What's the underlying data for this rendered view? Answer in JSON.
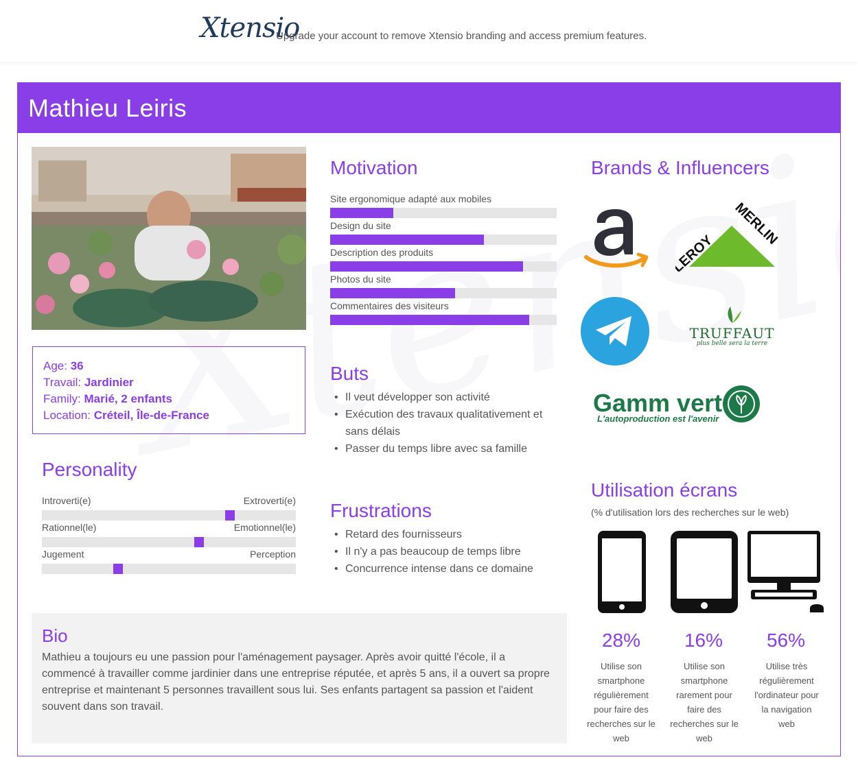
{
  "banner": {
    "logo": "Xtensio",
    "text": "Upgrade your account to remove Xtensio branding and access premium features."
  },
  "persona": {
    "name": "Mathieu Leiris",
    "info": [
      {
        "label": "Age: ",
        "value": "36"
      },
      {
        "label": "Travail: ",
        "value": "Jardinier"
      },
      {
        "label": "Family: ",
        "value": "Marié, 2 enfants"
      },
      {
        "label": "Location: ",
        "value": "Créteil, Île-de-France"
      }
    ]
  },
  "personality": {
    "title": "Personality",
    "sliders": [
      {
        "left": "Introverti(e)",
        "right": "Extroverti(e)",
        "level": 0.74
      },
      {
        "left": "Rationnel(le)",
        "right": "Emotionnel(le)",
        "level": 0.62
      },
      {
        "left": "Jugement",
        "right": "Perception",
        "level": 0.3
      }
    ]
  },
  "motivation": {
    "title": "Motivation",
    "items": [
      {
        "label": "Site ergonomique adapté aux mobiles",
        "level": 0.28
      },
      {
        "label": "Design du site",
        "level": 0.68
      },
      {
        "label": "Description des produits",
        "level": 0.85
      },
      {
        "label": "Photos du site",
        "level": 0.55
      },
      {
        "label": "Commentaires des visiteurs",
        "level": 0.88
      }
    ]
  },
  "goals": {
    "title": "Buts",
    "items": [
      "Il veut développer son activité",
      "Exécution des travaux qualitativement et sans délais",
      "Passer du temps libre avec sa famille"
    ]
  },
  "frustrations": {
    "title": "Frustrations",
    "items": [
      "Retard des fournisseurs",
      "Il n'y a pas beaucoup de temps libre",
      "Concurrence intense dans ce domaine"
    ]
  },
  "bio": {
    "title": "Bio",
    "text": "Mathieu a toujours eu une passion pour l'aménagement paysager. Après avoir quitté l'école, il a commencé à travailler comme jardinier dans une entreprise réputée, et après 5 ans, il a ouvert sa propre entreprise et maintenant 5 personnes travaillent sous lui. Ses enfants partagent sa passion et l'aident souvent dans son travail."
  },
  "brands": {
    "title": "Brands & Influencers",
    "items": [
      {
        "name": "amazon-logo"
      },
      {
        "name": "leroy-merlin-logo",
        "text": "LEROY MERLIN"
      },
      {
        "name": "telegram-logo"
      },
      {
        "name": "truffaut-logo",
        "text": "TRUFFAUT",
        "tagline": "plus belle sera la terre"
      },
      {
        "name": "gamm-vert-logo",
        "text": "Gamm vert",
        "tagline": "L'autoproduction est l'avenir"
      }
    ]
  },
  "screens": {
    "title": "Utilisation écrans",
    "subtitle": "(% d'utilisation lors des recherches sur le web)",
    "devices": [
      {
        "icon": "smartphone-icon",
        "percent": "28%",
        "desc": "Utilise son smartphone régulièrement pour faire des recherches sur le web"
      },
      {
        "icon": "tablet-icon",
        "percent": "16%",
        "desc": "Utilise son smartphone rarement pour faire des recherches sur le web"
      },
      {
        "icon": "desktop-computer-icon",
        "percent": "56%",
        "desc": "Utilise très régulièrement l'ordinateur pour la navigation web"
      }
    ]
  },
  "colors": {
    "accent": "#8a3ee8",
    "track": "#e6e6e6",
    "bio_bg": "#f2f2f2"
  }
}
